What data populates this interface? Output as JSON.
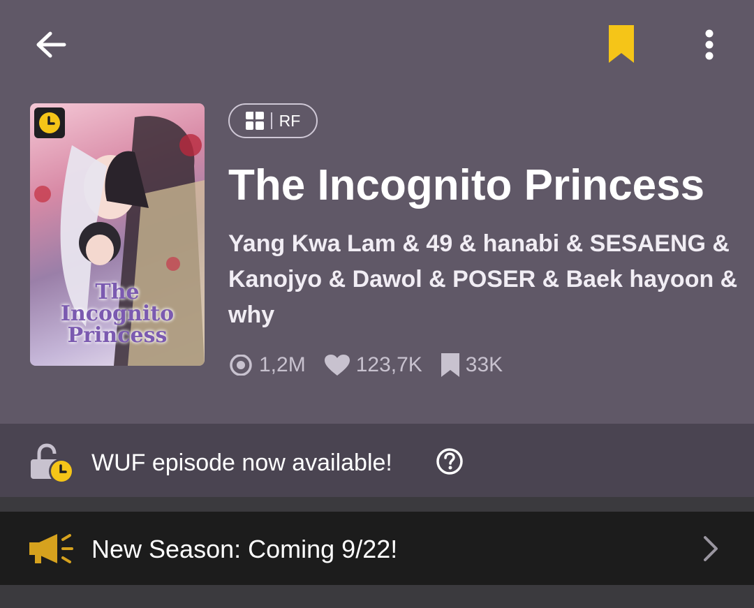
{
  "header": {
    "back_icon": "arrow-left-icon",
    "bookmark_icon": "bookmark-icon",
    "more_icon": "more-vertical-icon",
    "bookmark_color": "#f5c518"
  },
  "series": {
    "cover_title_lines": [
      "The",
      "Incognito",
      "Princess"
    ],
    "cover_badge_icon": "clock-icon",
    "genre_icon": "layout-grid-icon",
    "genre": "RF",
    "title": "The Incognito Princess",
    "authors": "Yang Kwa Lam & 49 & hanabi & SESAENG & Kanojyo & Dawol & POSER & Baek hayoon & why",
    "stats": {
      "views": "1,2M",
      "likes": "123,7K",
      "bookmarks": "33K"
    }
  },
  "wuf_notice": {
    "icon": "unlock-clock-icon",
    "text": "WUF episode now available!",
    "help_icon": "help-circle-icon"
  },
  "announcement": {
    "icon": "megaphone-icon",
    "text": "New Season: Coming 9/22!",
    "chevron_icon": "chevron-right-icon"
  },
  "colors": {
    "header_bg": "#605867",
    "accent": "#f5c518",
    "wuf_bg": "#4a4451",
    "announcement_bg": "#1c1c1c"
  }
}
